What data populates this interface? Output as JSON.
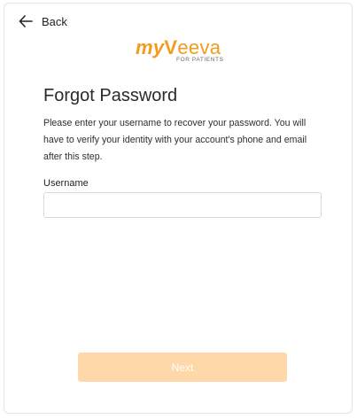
{
  "header": {
    "back_label": "Back",
    "back_icon": "arrow-left-icon"
  },
  "logo": {
    "my": "my",
    "v": "V",
    "eeva": "eeva",
    "subtitle": "FOR PATIENTS",
    "brand_color": "#f29b1d"
  },
  "form": {
    "title": "Forgot Password",
    "description": "Please enter your username to recover your password. You will have to verify your identity with your account's phone and email after this step.",
    "username_label": "Username",
    "username_value": "",
    "username_placeholder": "",
    "next_label": "Next",
    "next_button_color": "#fed8a8"
  }
}
